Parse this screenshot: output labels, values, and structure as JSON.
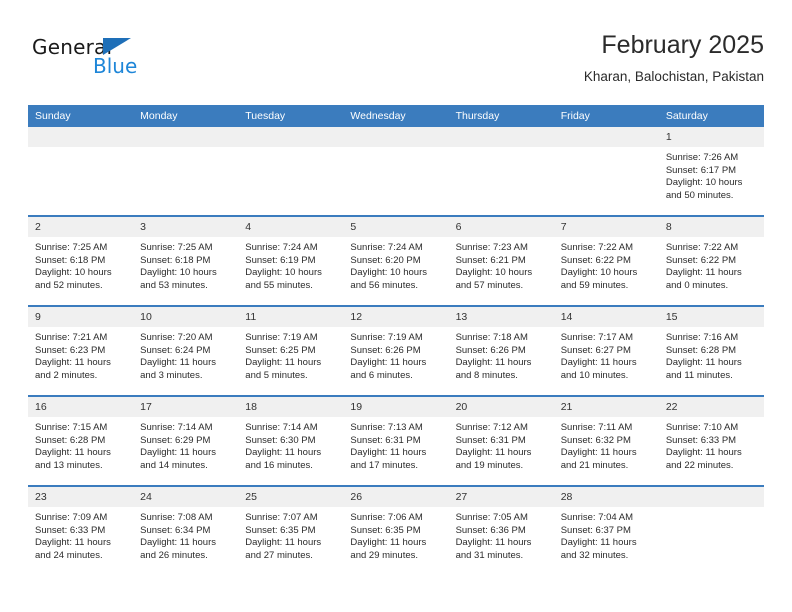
{
  "logo": {
    "word_top": "General",
    "word_bottom": "Blue",
    "triangle_icon": "triangle-icon",
    "brand_blue": "#1e86d8",
    "triangle_blue": "#1e6fb8"
  },
  "header": {
    "title": "February 2025",
    "subtitle": "Kharan, Balochistan, Pakistan"
  },
  "theme": {
    "header_bg": "#3b7cbe",
    "daynum_bg": "#f0f0f0",
    "text": "#2b2b2b"
  },
  "weekdays": [
    "Sunday",
    "Monday",
    "Tuesday",
    "Wednesday",
    "Thursday",
    "Friday",
    "Saturday"
  ],
  "weeks": [
    [
      {
        "day": "",
        "sunrise": "",
        "sunset": "",
        "daylight1": "",
        "daylight2": "",
        "empty": true
      },
      {
        "day": "",
        "sunrise": "",
        "sunset": "",
        "daylight1": "",
        "daylight2": "",
        "empty": true
      },
      {
        "day": "",
        "sunrise": "",
        "sunset": "",
        "daylight1": "",
        "daylight2": "",
        "empty": true
      },
      {
        "day": "",
        "sunrise": "",
        "sunset": "",
        "daylight1": "",
        "daylight2": "",
        "empty": true
      },
      {
        "day": "",
        "sunrise": "",
        "sunset": "",
        "daylight1": "",
        "daylight2": "",
        "empty": true
      },
      {
        "day": "",
        "sunrise": "",
        "sunset": "",
        "daylight1": "",
        "daylight2": "",
        "empty": true
      },
      {
        "day": "1",
        "sunrise": "Sunrise: 7:26 AM",
        "sunset": "Sunset: 6:17 PM",
        "daylight1": "Daylight: 10 hours",
        "daylight2": "and 50 minutes."
      }
    ],
    [
      {
        "day": "2",
        "sunrise": "Sunrise: 7:25 AM",
        "sunset": "Sunset: 6:18 PM",
        "daylight1": "Daylight: 10 hours",
        "daylight2": "and 52 minutes."
      },
      {
        "day": "3",
        "sunrise": "Sunrise: 7:25 AM",
        "sunset": "Sunset: 6:18 PM",
        "daylight1": "Daylight: 10 hours",
        "daylight2": "and 53 minutes."
      },
      {
        "day": "4",
        "sunrise": "Sunrise: 7:24 AM",
        "sunset": "Sunset: 6:19 PM",
        "daylight1": "Daylight: 10 hours",
        "daylight2": "and 55 minutes."
      },
      {
        "day": "5",
        "sunrise": "Sunrise: 7:24 AM",
        "sunset": "Sunset: 6:20 PM",
        "daylight1": "Daylight: 10 hours",
        "daylight2": "and 56 minutes."
      },
      {
        "day": "6",
        "sunrise": "Sunrise: 7:23 AM",
        "sunset": "Sunset: 6:21 PM",
        "daylight1": "Daylight: 10 hours",
        "daylight2": "and 57 minutes."
      },
      {
        "day": "7",
        "sunrise": "Sunrise: 7:22 AM",
        "sunset": "Sunset: 6:22 PM",
        "daylight1": "Daylight: 10 hours",
        "daylight2": "and 59 minutes."
      },
      {
        "day": "8",
        "sunrise": "Sunrise: 7:22 AM",
        "sunset": "Sunset: 6:22 PM",
        "daylight1": "Daylight: 11 hours",
        "daylight2": "and 0 minutes."
      }
    ],
    [
      {
        "day": "9",
        "sunrise": "Sunrise: 7:21 AM",
        "sunset": "Sunset: 6:23 PM",
        "daylight1": "Daylight: 11 hours",
        "daylight2": "and 2 minutes."
      },
      {
        "day": "10",
        "sunrise": "Sunrise: 7:20 AM",
        "sunset": "Sunset: 6:24 PM",
        "daylight1": "Daylight: 11 hours",
        "daylight2": "and 3 minutes."
      },
      {
        "day": "11",
        "sunrise": "Sunrise: 7:19 AM",
        "sunset": "Sunset: 6:25 PM",
        "daylight1": "Daylight: 11 hours",
        "daylight2": "and 5 minutes."
      },
      {
        "day": "12",
        "sunrise": "Sunrise: 7:19 AM",
        "sunset": "Sunset: 6:26 PM",
        "daylight1": "Daylight: 11 hours",
        "daylight2": "and 6 minutes."
      },
      {
        "day": "13",
        "sunrise": "Sunrise: 7:18 AM",
        "sunset": "Sunset: 6:26 PM",
        "daylight1": "Daylight: 11 hours",
        "daylight2": "and 8 minutes."
      },
      {
        "day": "14",
        "sunrise": "Sunrise: 7:17 AM",
        "sunset": "Sunset: 6:27 PM",
        "daylight1": "Daylight: 11 hours",
        "daylight2": "and 10 minutes."
      },
      {
        "day": "15",
        "sunrise": "Sunrise: 7:16 AM",
        "sunset": "Sunset: 6:28 PM",
        "daylight1": "Daylight: 11 hours",
        "daylight2": "and 11 minutes."
      }
    ],
    [
      {
        "day": "16",
        "sunrise": "Sunrise: 7:15 AM",
        "sunset": "Sunset: 6:28 PM",
        "daylight1": "Daylight: 11 hours",
        "daylight2": "and 13 minutes."
      },
      {
        "day": "17",
        "sunrise": "Sunrise: 7:14 AM",
        "sunset": "Sunset: 6:29 PM",
        "daylight1": "Daylight: 11 hours",
        "daylight2": "and 14 minutes."
      },
      {
        "day": "18",
        "sunrise": "Sunrise: 7:14 AM",
        "sunset": "Sunset: 6:30 PM",
        "daylight1": "Daylight: 11 hours",
        "daylight2": "and 16 minutes."
      },
      {
        "day": "19",
        "sunrise": "Sunrise: 7:13 AM",
        "sunset": "Sunset: 6:31 PM",
        "daylight1": "Daylight: 11 hours",
        "daylight2": "and 17 minutes."
      },
      {
        "day": "20",
        "sunrise": "Sunrise: 7:12 AM",
        "sunset": "Sunset: 6:31 PM",
        "daylight1": "Daylight: 11 hours",
        "daylight2": "and 19 minutes."
      },
      {
        "day": "21",
        "sunrise": "Sunrise: 7:11 AM",
        "sunset": "Sunset: 6:32 PM",
        "daylight1": "Daylight: 11 hours",
        "daylight2": "and 21 minutes."
      },
      {
        "day": "22",
        "sunrise": "Sunrise: 7:10 AM",
        "sunset": "Sunset: 6:33 PM",
        "daylight1": "Daylight: 11 hours",
        "daylight2": "and 22 minutes."
      }
    ],
    [
      {
        "day": "23",
        "sunrise": "Sunrise: 7:09 AM",
        "sunset": "Sunset: 6:33 PM",
        "daylight1": "Daylight: 11 hours",
        "daylight2": "and 24 minutes."
      },
      {
        "day": "24",
        "sunrise": "Sunrise: 7:08 AM",
        "sunset": "Sunset: 6:34 PM",
        "daylight1": "Daylight: 11 hours",
        "daylight2": "and 26 minutes."
      },
      {
        "day": "25",
        "sunrise": "Sunrise: 7:07 AM",
        "sunset": "Sunset: 6:35 PM",
        "daylight1": "Daylight: 11 hours",
        "daylight2": "and 27 minutes."
      },
      {
        "day": "26",
        "sunrise": "Sunrise: 7:06 AM",
        "sunset": "Sunset: 6:35 PM",
        "daylight1": "Daylight: 11 hours",
        "daylight2": "and 29 minutes."
      },
      {
        "day": "27",
        "sunrise": "Sunrise: 7:05 AM",
        "sunset": "Sunset: 6:36 PM",
        "daylight1": "Daylight: 11 hours",
        "daylight2": "and 31 minutes."
      },
      {
        "day": "28",
        "sunrise": "Sunrise: 7:04 AM",
        "sunset": "Sunset: 6:37 PM",
        "daylight1": "Daylight: 11 hours",
        "daylight2": "and 32 minutes."
      },
      {
        "day": "",
        "sunrise": "",
        "sunset": "",
        "daylight1": "",
        "daylight2": "",
        "empty": true
      }
    ]
  ]
}
